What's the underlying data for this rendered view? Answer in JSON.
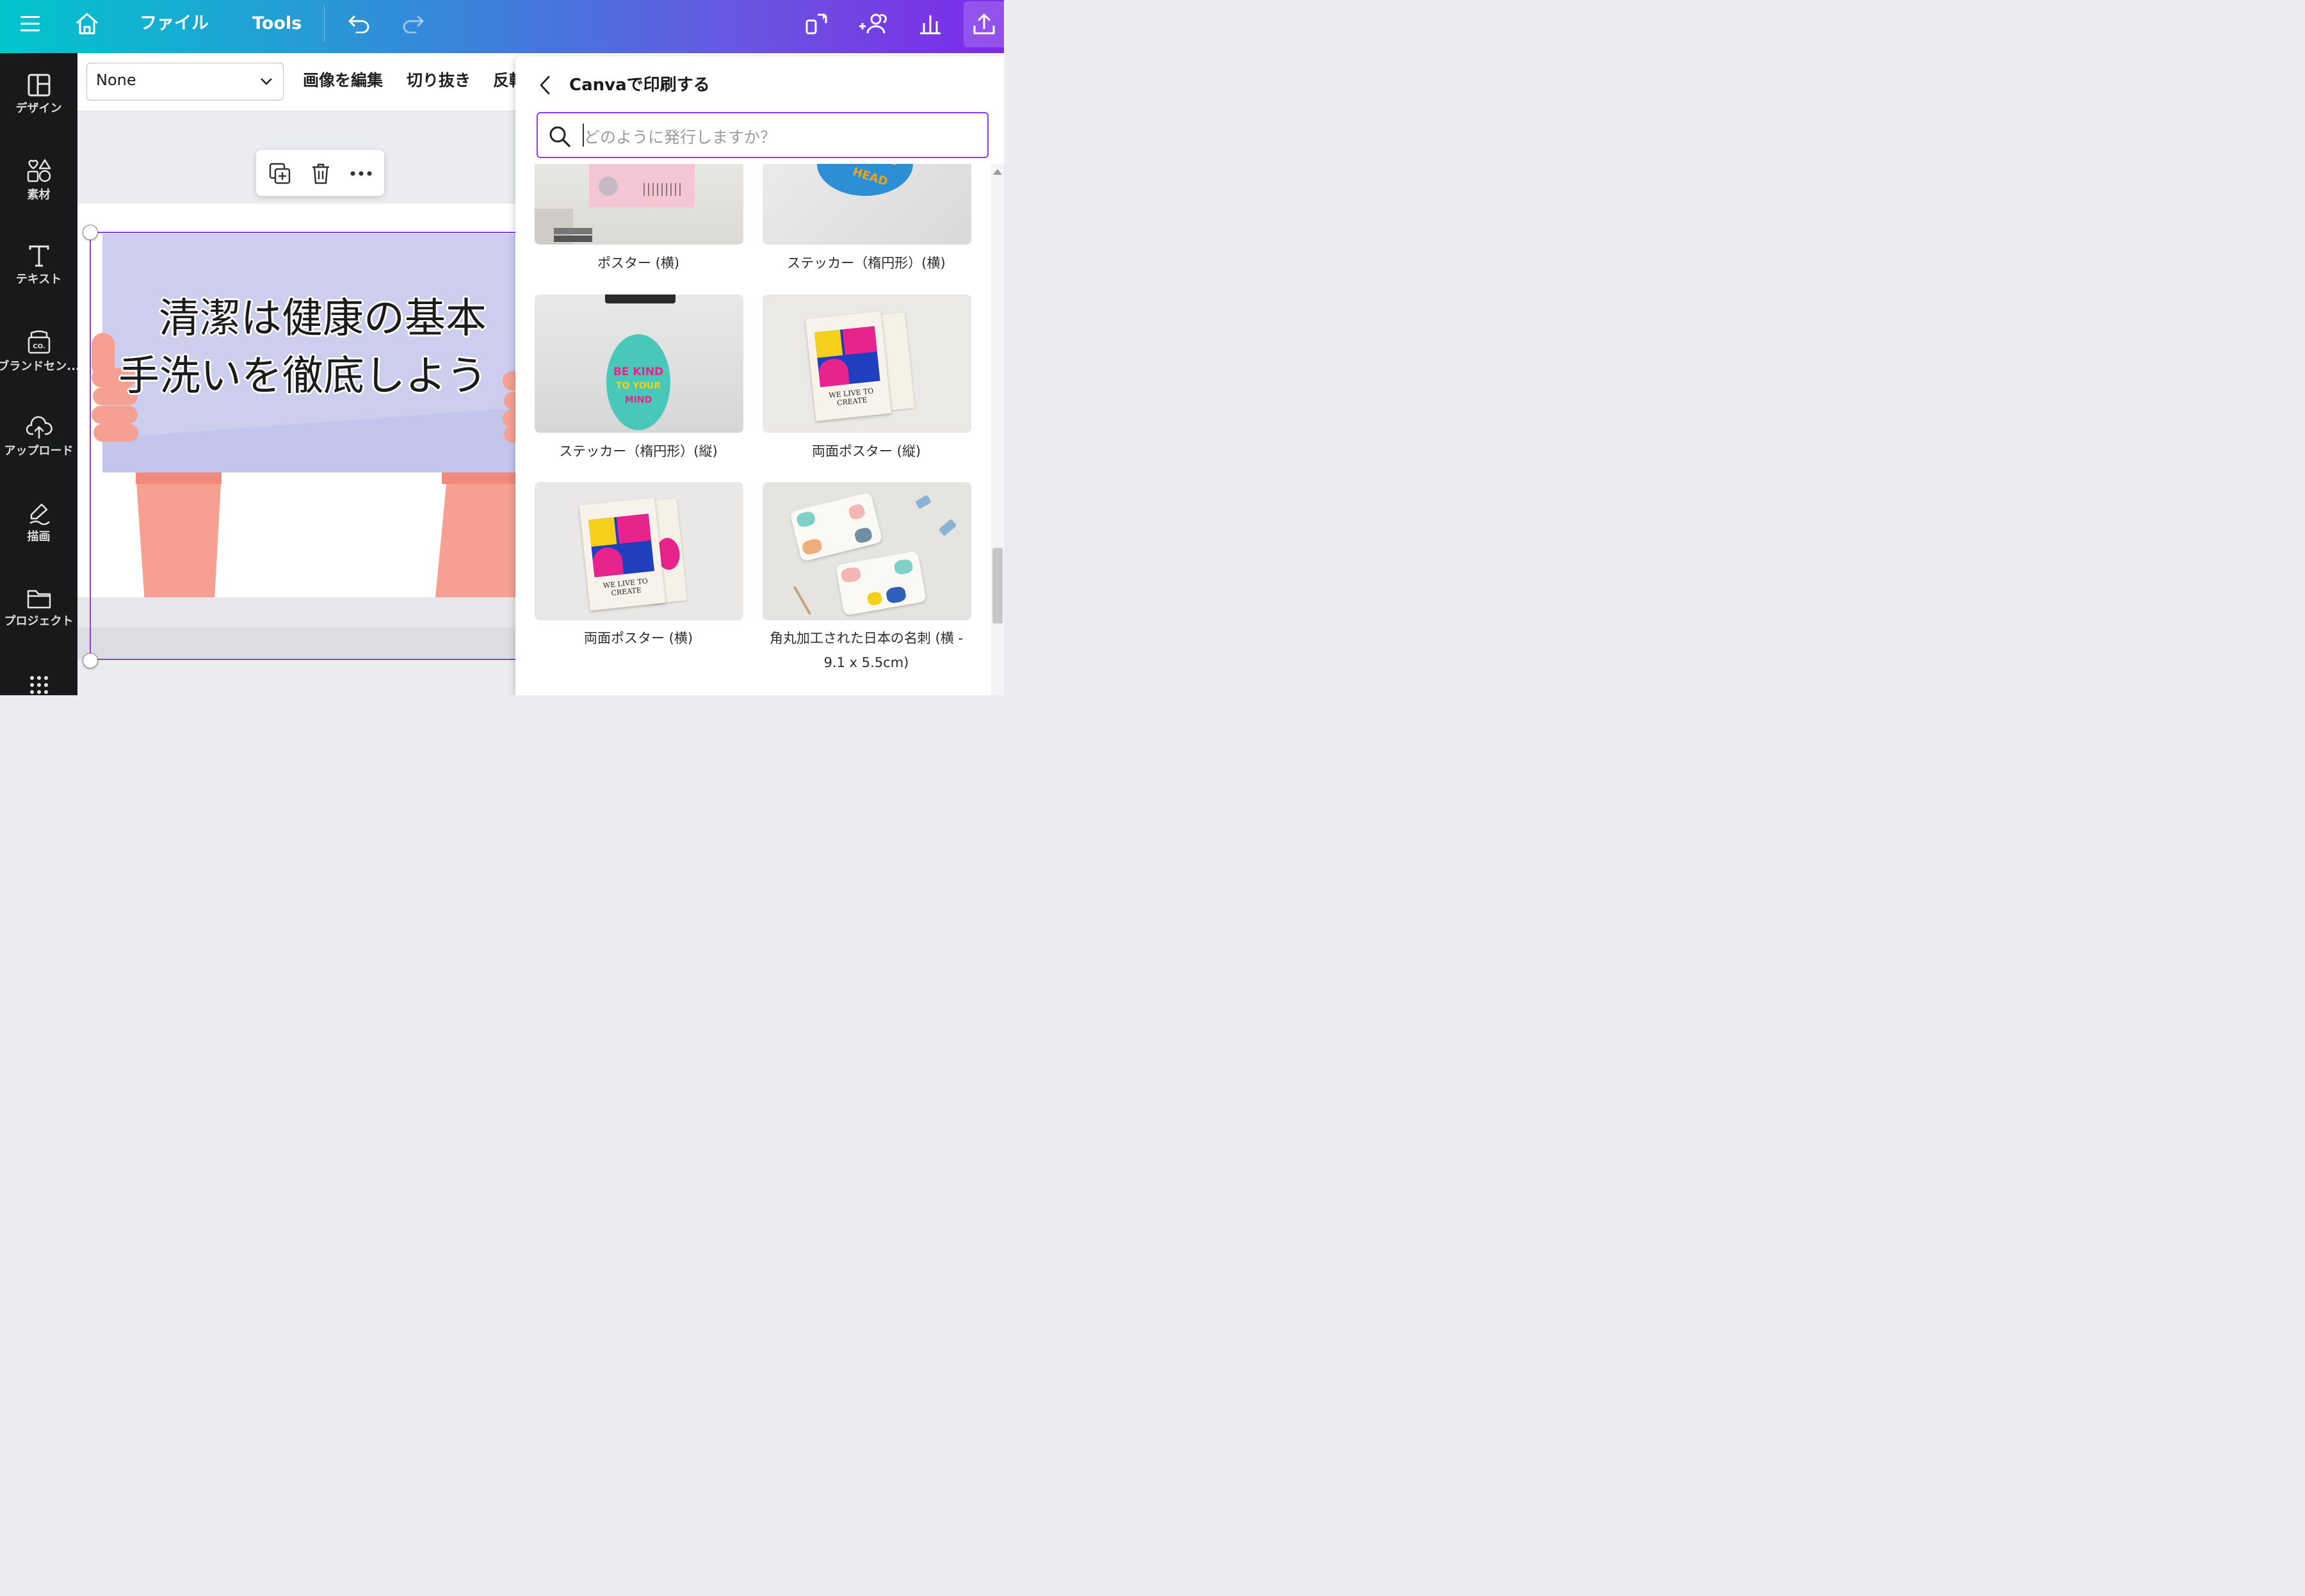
{
  "topbar": {
    "file_label": "ファイル",
    "tools_label": "Tools",
    "icons": [
      "menu-icon",
      "home-icon",
      "undo-icon",
      "redo-icon",
      "magic-resize-icon",
      "share-people-icon",
      "insights-icon",
      "share-upload-icon"
    ]
  },
  "sidebar": {
    "items": [
      {
        "label": "デザイン",
        "icon": "layout-icon"
      },
      {
        "label": "素材",
        "icon": "elements-icon"
      },
      {
        "label": "テキスト",
        "icon": "text-icon"
      },
      {
        "label": "ブランドセン...",
        "icon": "brand-icon"
      },
      {
        "label": "アップロード",
        "icon": "upload-cloud-icon"
      },
      {
        "label": "描画",
        "icon": "draw-icon"
      },
      {
        "label": "プロジェクト",
        "icon": "folder-icon"
      }
    ]
  },
  "context_toolbar": {
    "select_value": "None",
    "edit_image": "画像を編集",
    "crop": "切り抜き",
    "flip": "反転"
  },
  "canvas": {
    "line1": "清潔は健康の基本",
    "line2": "手洗いを徹底しよう"
  },
  "panel": {
    "title": "Canvaで印刷する",
    "search_placeholder": "どのように発行しますか？",
    "cards": [
      {
        "label": "ポスター (横)"
      },
      {
        "label": "ステッカー（楕円形）(横)"
      },
      {
        "label": "ステッカー（楕円形）(縦)",
        "sticker_line1": "BE KIND",
        "sticker_line2": "TO YOUR",
        "sticker_line3": "MIND"
      },
      {
        "label": "両面ポスター (縦)",
        "poster_text": "WE LIVE TO CREATE"
      },
      {
        "label": "両面ポスター (横)",
        "poster_text": "WE LIVE TO CREATE"
      },
      {
        "label_line1": "角丸加工された日本の名刺 (横 -",
        "label_line2": "9.1 x 5.5cm)"
      }
    ]
  },
  "colors": {
    "accent": "#8b3dff",
    "topbar_start": "#01c4cc",
    "topbar_end": "#7d2ae8",
    "sidebar_bg": "#18191b",
    "sign_bg": "#c4c5ec",
    "skin": "#f5a092"
  }
}
